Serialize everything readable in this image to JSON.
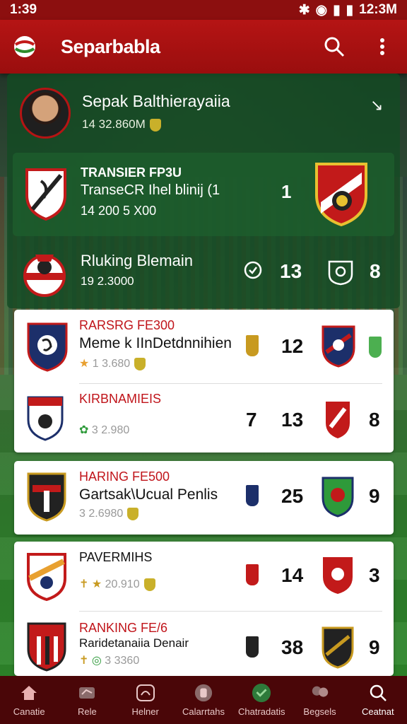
{
  "status": {
    "time_left": "1:39",
    "time_right": "12:3M"
  },
  "appbar": {
    "title": "Separbabla"
  },
  "profile": {
    "name": "Sepak Balthierayaiia",
    "sub": "14 32.860M"
  },
  "transfer": {
    "title": "TRANSIER FP3U",
    "name": "TranseCR Ihel blinij (1",
    "sub": "14 200 5 X00",
    "num": "1"
  },
  "ranking": {
    "title": "Rluking Blemain",
    "sub": "19 2.3000",
    "stat1": "13",
    "stat2": "8"
  },
  "rows": [
    {
      "label": "RARSRG FE300",
      "name": "Meme k IInDetdnnihien",
      "sub": "1 3.680",
      "n1": "12",
      "n2": ""
    },
    {
      "label": "KIRBNAMIEIS",
      "name": "",
      "sub": "3 2.980",
      "n1": "7",
      "n2": "13",
      "n3": "8"
    },
    {
      "label": "HARING FE500",
      "name": "Gartsak\\Ucual Penlis",
      "sub": "3 2.6980",
      "n1": "25",
      "n3": "9"
    },
    {
      "label": "PAVERMIHS",
      "name": "",
      "sub": "20.910",
      "n1": "14",
      "n3": "3"
    },
    {
      "label": "RANKING FE/6",
      "name": "Raridetanaiia Denair",
      "sub": "3 3360",
      "n1": "38",
      "n3": "9"
    }
  ],
  "nav": [
    {
      "label": "Canatie",
      "icon": "home-icon"
    },
    {
      "label": "Rele",
      "icon": "stats-icon"
    },
    {
      "label": "Helner",
      "icon": "gauge-icon"
    },
    {
      "label": "Calarrtahs",
      "icon": "badge-icon"
    },
    {
      "label": "Chatradatis",
      "icon": "chat-icon"
    },
    {
      "label": "Begsels",
      "icon": "group-icon"
    },
    {
      "label": "Ceatnat",
      "icon": "search-icon"
    }
  ]
}
